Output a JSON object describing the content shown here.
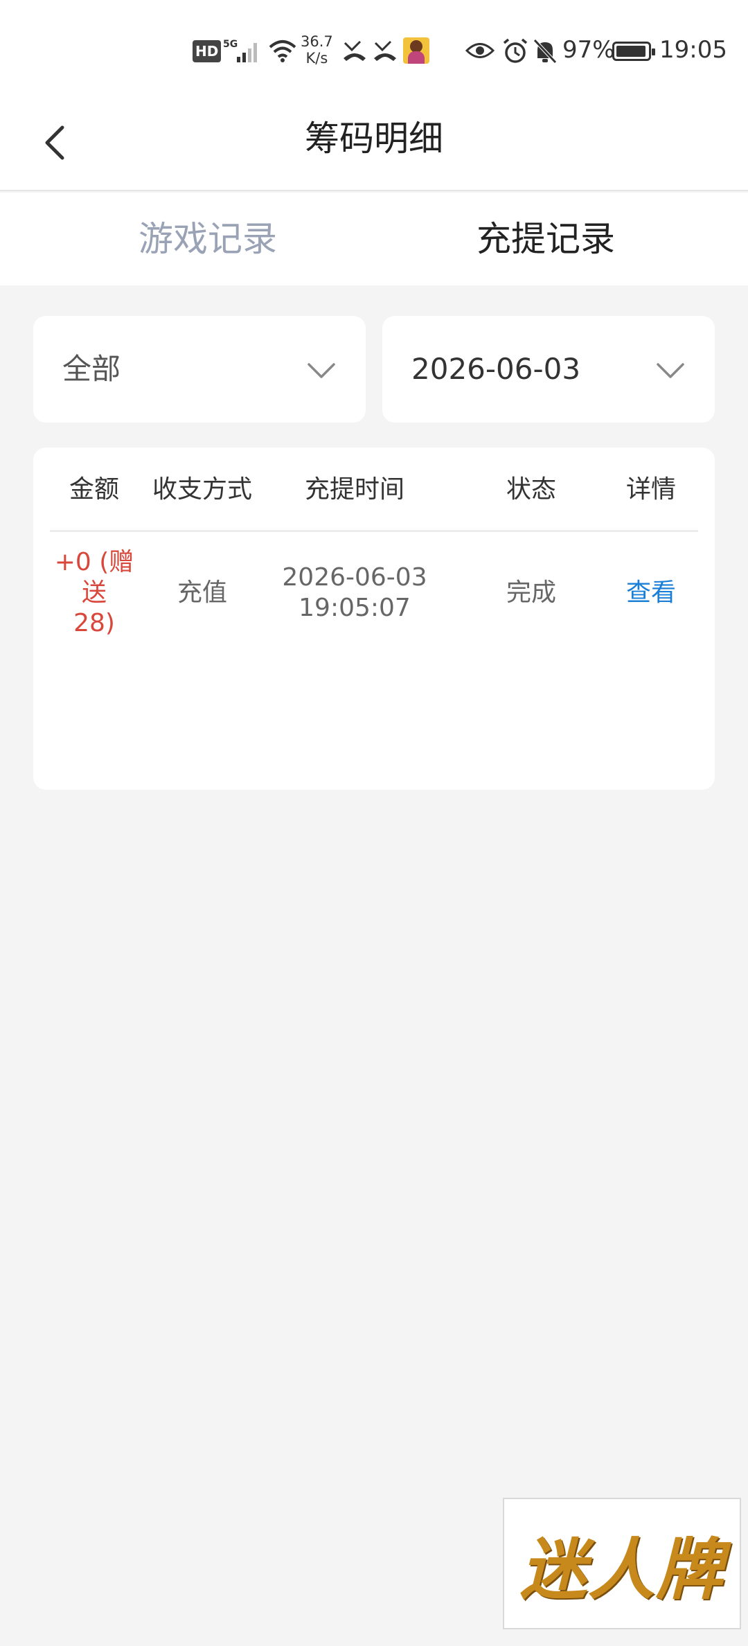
{
  "status_bar": {
    "hd": "HD",
    "net_speed_value": "36.7",
    "net_speed_unit": "K/s",
    "battery": "97%",
    "time": "19:05"
  },
  "header": {
    "title": "筹码明细"
  },
  "tabs": [
    {
      "label": "游戏记录",
      "active": false
    },
    {
      "label": "充提记录",
      "active": true
    }
  ],
  "filters": {
    "type": "全部",
    "date": "2026-06-03"
  },
  "table": {
    "columns": [
      "金额",
      "收支方式",
      "充提时间",
      "状态",
      "详情"
    ],
    "rows": [
      {
        "amount_line1": "+0 (赠送",
        "amount_line2": "28)",
        "method": "充值",
        "date": "2026-06-03",
        "time": "19:05:07",
        "status": "完成",
        "detail": "查看"
      }
    ]
  },
  "brand": {
    "logo_text": "迷人牌"
  },
  "colors": {
    "accent_blue": "#1a7fd6",
    "amount_red": "#d9463a",
    "inactive_tab": "#9aa3b5",
    "page_bg": "#f4f4f5"
  }
}
